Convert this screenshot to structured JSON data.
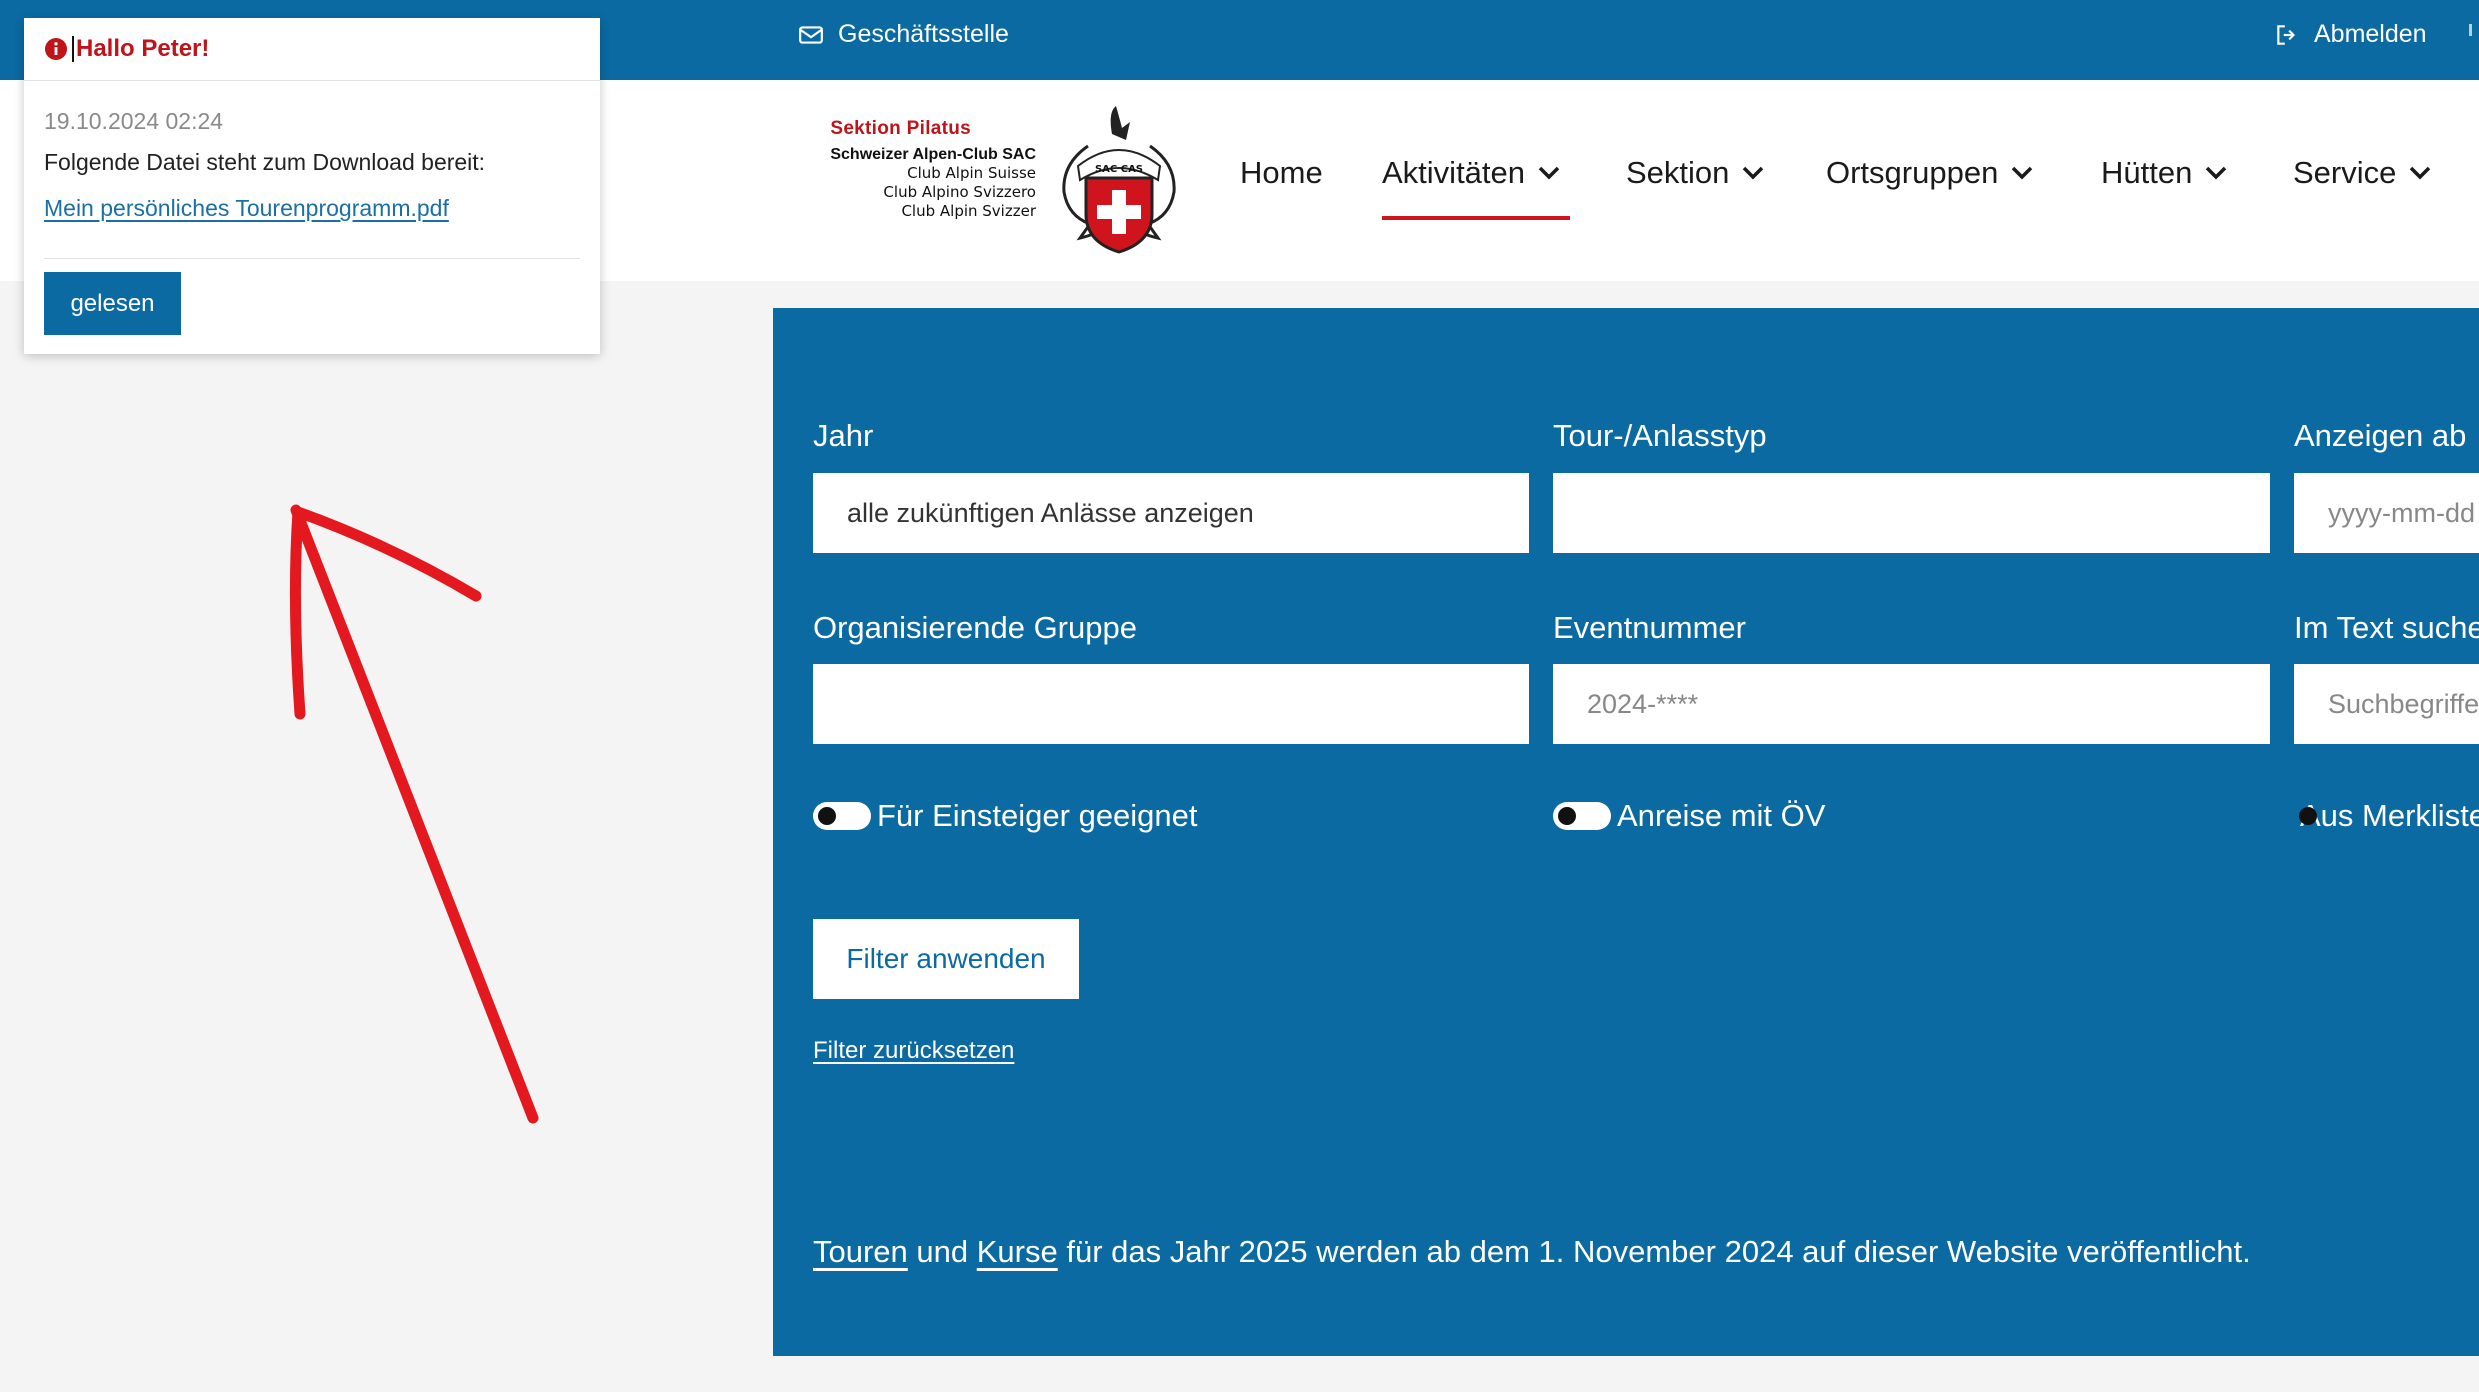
{
  "topbar": {
    "office_label": "Geschäftsstelle",
    "logout_label": "Abmelden"
  },
  "brand": {
    "section": "Sektion Pilatus",
    "line1": "Schweizer Alpen-Club SAC",
    "line2": "Club Alpin Suisse",
    "line3": "Club Alpino Svizzero",
    "line4": "Club Alpin Svizzer",
    "emblem_text": "SAC CAS"
  },
  "nav": {
    "items": [
      {
        "label": "Home"
      },
      {
        "label": "Aktivitäten"
      },
      {
        "label": "Sektion"
      },
      {
        "label": "Ortsgruppen"
      },
      {
        "label": "Hütten"
      },
      {
        "label": "Service"
      }
    ],
    "active": "Aktivitäten"
  },
  "filters": {
    "year": {
      "label": "Jahr",
      "value": "alle zukünftigen Anlässe anzeigen"
    },
    "tour_type": {
      "label": "Tour-/Anlasstyp",
      "value": ""
    },
    "show_from": {
      "label": "Anzeigen ab",
      "placeholder": "yyyy-mm-dd"
    },
    "group": {
      "label": "Organisierende Gruppe",
      "value": ""
    },
    "event_number": {
      "label": "Eventnummer",
      "placeholder": "2024-****"
    },
    "text_search": {
      "label": "Im Text suchen",
      "placeholder": "Suchbegriffe"
    },
    "toggle_beginner": {
      "label": "Für Einsteiger geeignet",
      "checked": false
    },
    "toggle_public_transport": {
      "label": "Anreise mit ÖV",
      "checked": false
    },
    "toggle_bookmarks": {
      "label": "Aus Merkliste",
      "checked": false
    },
    "apply_label": "Filter anwenden",
    "reset_label": "Filter zurücksetzen"
  },
  "info": {
    "touren": "Touren",
    "und": " und ",
    "kurse": "Kurse",
    "rest": " für das Jahr 2025 werden ab dem 1. November 2024 auf dieser Website veröffentlicht."
  },
  "notification": {
    "title": "Hallo Peter!",
    "date": "19.10.2024 02:24",
    "message": "Folgende Datei steht zum Download bereit:",
    "link": "Mein persönliches Tourenprogramm.pdf",
    "button": "gelesen"
  },
  "colors": {
    "primary": "#0b6aa2",
    "accent_red": "#c0141b",
    "annotation_arrow": "#e3191f"
  }
}
